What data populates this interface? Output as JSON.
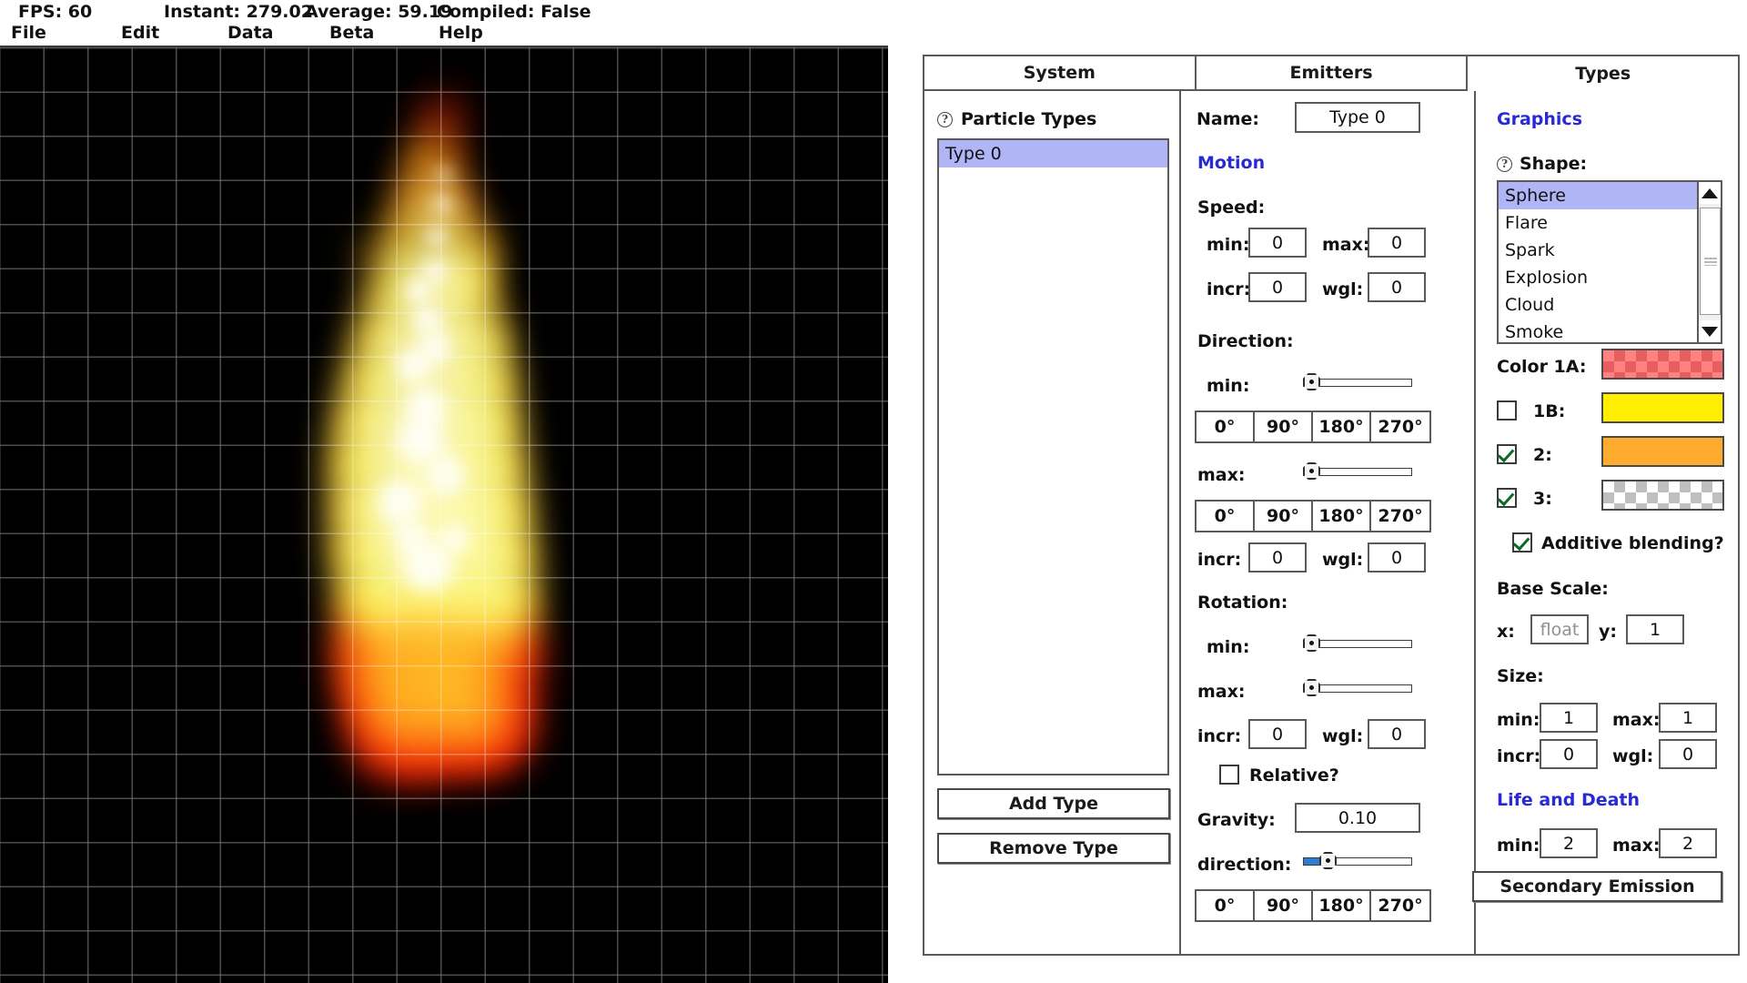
{
  "statusbar": {
    "fps": "FPS: 60",
    "instant": "Instant: 279.02",
    "average": "Average: 59.19",
    "compiled": "Compiled: False"
  },
  "menubar": {
    "file": "File",
    "edit": "Edit",
    "data": "Data",
    "beta": "Beta",
    "help": "Help"
  },
  "viewport": {
    "background_color": "#000000",
    "grid_color": "#7d7d7d",
    "effect": "fire-particle-emitter"
  },
  "panel": {
    "tabs": [
      {
        "label": "System",
        "active": false
      },
      {
        "label": "Emitters",
        "active": false
      },
      {
        "label": "Types",
        "active": true
      }
    ],
    "left_column": {
      "heading": "Particle Types",
      "help_icon": "question-circle-icon",
      "list_items": [
        "Type 0"
      ],
      "selected_index": 0,
      "add_button": "Add Type",
      "remove_button": "Remove Type"
    },
    "middle_column": {
      "name_label": "Name:",
      "name_value": "Type 0",
      "motion_heading": "Motion",
      "speed": {
        "label": "Speed:",
        "min_label": "min:",
        "min_value": "0",
        "max_label": "max:",
        "max_value": "0",
        "incr_label": "incr:",
        "incr_value": "0",
        "wgl_label": "wgl:",
        "wgl_value": "0"
      },
      "direction": {
        "label": "Direction:",
        "min_label": "min:",
        "min_slider_pct": 0,
        "max_label": "max:",
        "max_slider_pct": 0,
        "degree_buttons": [
          "0°",
          "90°",
          "180°",
          "270°"
        ],
        "incr_label": "incr:",
        "incr_value": "0",
        "wgl_label": "wgl:",
        "wgl_value": "0"
      },
      "rotation": {
        "label": "Rotation:",
        "min_label": "min:",
        "min_slider_pct": 0,
        "max_label": "max:",
        "max_slider_pct": 0,
        "incr_label": "incr:",
        "incr_value": "0",
        "wgl_label": "wgl:",
        "wgl_value": "0",
        "relative_label": "Relative?",
        "relative_checked": false
      },
      "gravity": {
        "label": "Gravity:",
        "value": "0.10",
        "direction_label": "direction:",
        "direction_slider_pct": 18,
        "degree_buttons": [
          "0°",
          "90°",
          "180°",
          "270°"
        ]
      }
    },
    "right_column": {
      "graphics_heading": "Graphics",
      "shape": {
        "label": "Shape:",
        "help_icon": "question-circle-icon",
        "options": [
          "Sphere",
          "Flare",
          "Spark",
          "Explosion",
          "Cloud",
          "Smoke"
        ],
        "selected": "Sphere"
      },
      "colors": [
        {
          "label": "Color 1A:",
          "checkbox": null,
          "hex": "#e85d5d",
          "alpha_checker": true
        },
        {
          "label": "1B:",
          "checkbox": false,
          "hex": "#ffee00",
          "alpha_checker": false
        },
        {
          "label": "2:",
          "checkbox": true,
          "hex": "#ffab2e",
          "alpha_checker": false
        },
        {
          "label": "3:",
          "checkbox": true,
          "hex": "#bfbfbf",
          "alpha_checker": true
        }
      ],
      "additive_blending": {
        "label": "Additive blending?",
        "checked": true
      },
      "base_scale": {
        "label": "Base Scale:",
        "x_label": "x:",
        "x_value": "float",
        "x_is_placeholder": true,
        "y_label": "y:",
        "y_value": "1"
      },
      "size": {
        "label": "Size:",
        "min_label": "min:",
        "min_value": "1",
        "max_label": "max:",
        "max_value": "1",
        "incr_label": "incr:",
        "incr_value": "0",
        "wgl_label": "wgl:",
        "wgl_value": "0"
      },
      "life_and_death": {
        "heading": "Life and Death",
        "min_label": "min:",
        "min_value": "2",
        "max_label": "max:",
        "max_value": "2"
      },
      "secondary_emission_button": "Secondary Emission"
    }
  }
}
